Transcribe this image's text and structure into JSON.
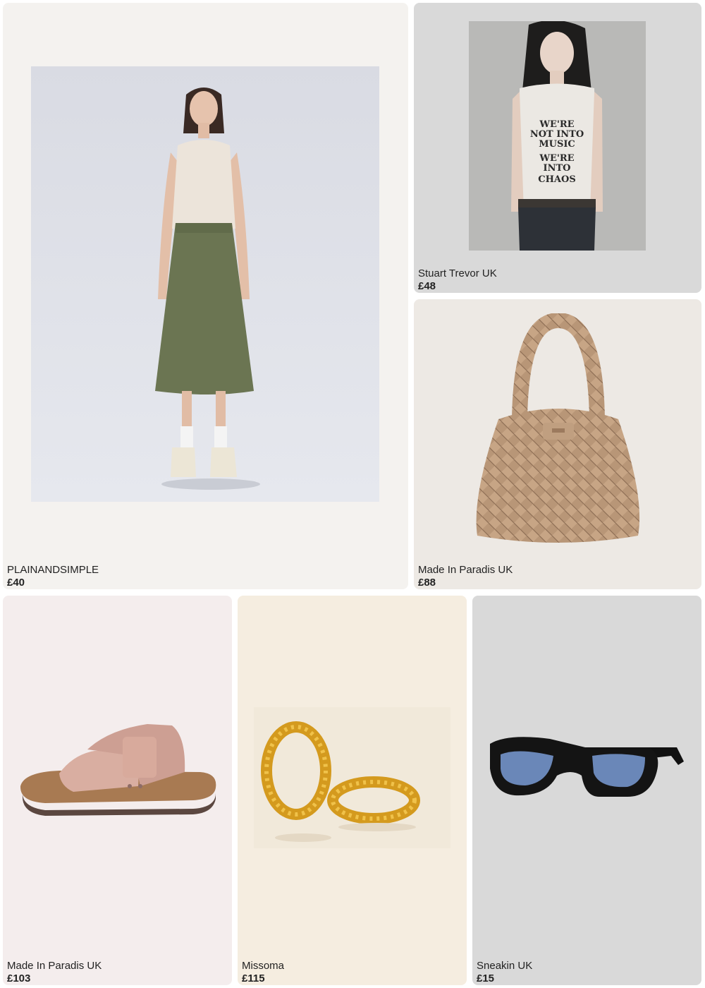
{
  "products": [
    {
      "brand": "PLAINANDSIMPLE",
      "price": "£40",
      "card_bg": "#f4f2ef",
      "icon": "skirt-outfit-image"
    },
    {
      "brand": "Stuart Trevor UK",
      "price": "£48",
      "card_bg": "#d9d9d9",
      "icon": "band-tshirt-image",
      "shirt_text": [
        "WE'RE",
        "NOT INTO",
        "MUSIC",
        "WE'RE",
        "INTO",
        "CHAOS"
      ]
    },
    {
      "brand": "Made In Paradis UK",
      "price": "£88",
      "card_bg": "#ede9e4",
      "icon": "woven-bag-image"
    },
    {
      "brand": "Made In Paradis UK",
      "price": "£103",
      "card_bg": "#f4eded",
      "icon": "suede-sandal-image"
    },
    {
      "brand": "Missoma",
      "price": "£115",
      "card_bg": "#f5ede0",
      "icon": "gold-hoop-earrings-image"
    },
    {
      "brand": "Sneakin UK",
      "price": "£15",
      "card_bg": "#d9d9d9",
      "icon": "sunglasses-image"
    }
  ]
}
